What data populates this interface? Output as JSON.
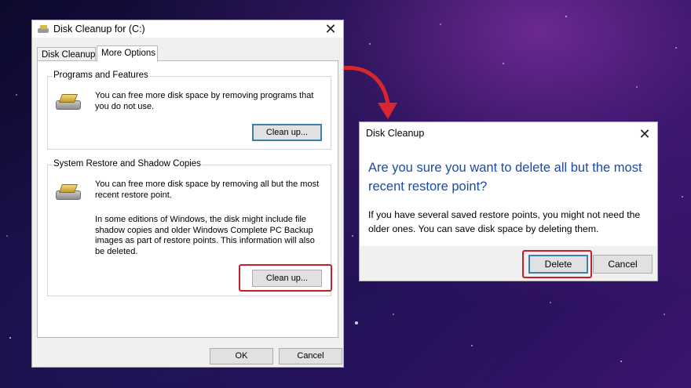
{
  "main_dialog": {
    "title": "Disk Cleanup for  (C:)",
    "close_glyph": "✕",
    "tabs": [
      {
        "label": "Disk Cleanup",
        "active": false
      },
      {
        "label": "More Options",
        "active": true
      }
    ],
    "programs_group": {
      "label": "Programs and Features",
      "icon": "disk-cleanup-icon",
      "text": "You can free more disk space by removing programs that you do not use.",
      "button": "Clean up..."
    },
    "restore_group": {
      "label": "System Restore and Shadow Copies",
      "icon": "disk-cleanup-icon",
      "text1": "You can free more disk space by removing all but the most recent restore point.",
      "text2": "In some editions of Windows, the disk might include file shadow copies and older Windows Complete PC Backup images as part of restore points. This information will also be deleted.",
      "button": "Clean up..."
    },
    "ok_button": "OK",
    "cancel_button": "Cancel"
  },
  "confirm_dialog": {
    "title": "Disk Cleanup",
    "close_glyph": "✕",
    "heading": "Are you sure you want to delete all but the most recent restore point?",
    "message": "If you have several saved restore points, you might not need the older ones. You can save disk space by deleting them.",
    "delete_button": "Delete",
    "cancel_button": "Cancel"
  },
  "colors": {
    "highlight": "#c8202a",
    "heading_blue": "#1f4aa0",
    "arrow": "#d8262e"
  }
}
